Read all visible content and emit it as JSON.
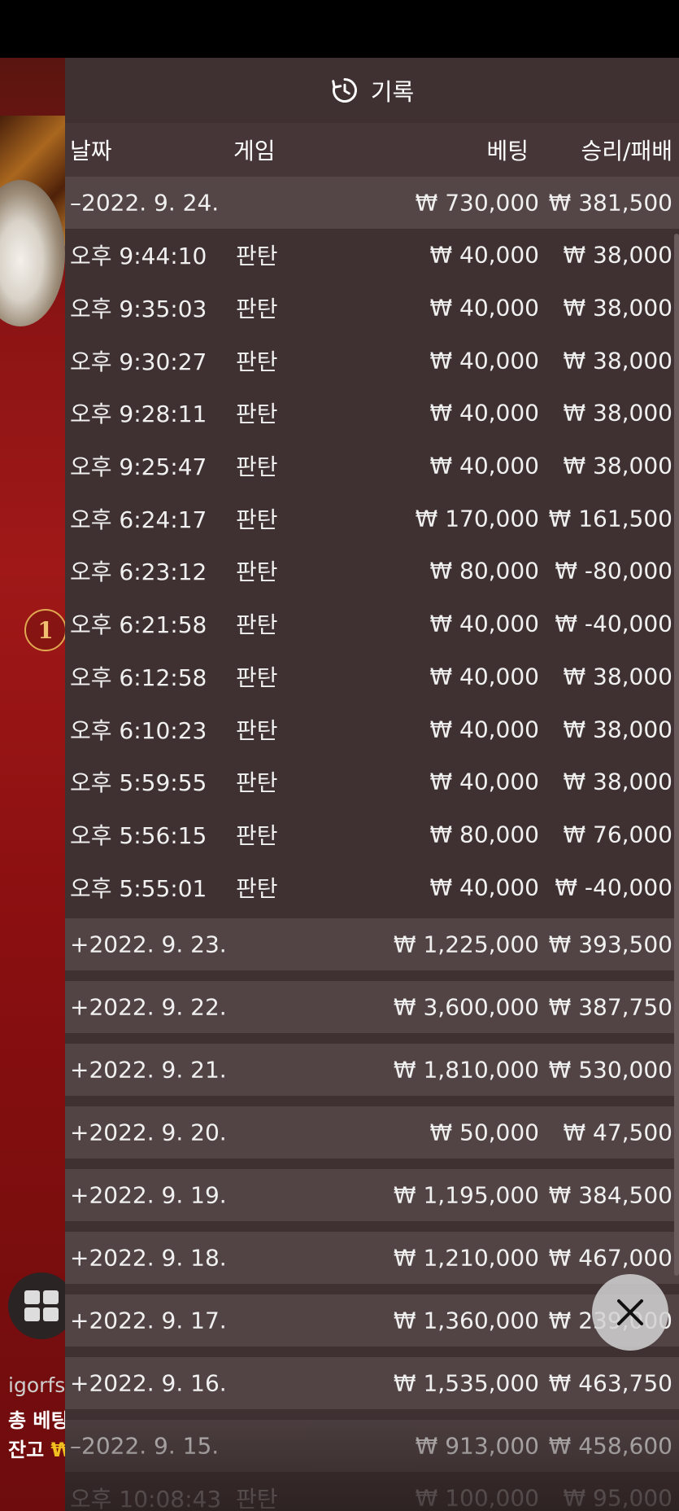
{
  "panel": {
    "title": "기록",
    "icon": "history-icon",
    "columns": {
      "date": "날짜",
      "game": "게임",
      "bet": "베팅",
      "result": "승리/패배"
    }
  },
  "expanded_day": {
    "date": "–2022. 9. 24.",
    "bet": "₩ 730,000",
    "result": "₩ 381,500",
    "entries": [
      {
        "time": "오후 9:44:10",
        "game": "판탄",
        "bet": "₩ 40,000",
        "result": "₩ 38,000"
      },
      {
        "time": "오후 9:35:03",
        "game": "판탄",
        "bet": "₩ 40,000",
        "result": "₩ 38,000"
      },
      {
        "time": "오후 9:30:27",
        "game": "판탄",
        "bet": "₩ 40,000",
        "result": "₩ 38,000"
      },
      {
        "time": "오후 9:28:11",
        "game": "판탄",
        "bet": "₩ 40,000",
        "result": "₩ 38,000"
      },
      {
        "time": "오후 9:25:47",
        "game": "판탄",
        "bet": "₩ 40,000",
        "result": "₩ 38,000"
      },
      {
        "time": "오후 6:24:17",
        "game": "판탄",
        "bet": "₩ 170,000",
        "result": "₩ 161,500"
      },
      {
        "time": "오후 6:23:12",
        "game": "판탄",
        "bet": "₩ 80,000",
        "result": "₩ -80,000"
      },
      {
        "time": "오후 6:21:58",
        "game": "판탄",
        "bet": "₩ 40,000",
        "result": "₩ -40,000"
      },
      {
        "time": "오후 6:12:58",
        "game": "판탄",
        "bet": "₩ 40,000",
        "result": "₩ 38,000"
      },
      {
        "time": "오후 6:10:23",
        "game": "판탄",
        "bet": "₩ 40,000",
        "result": "₩ 38,000"
      },
      {
        "time": "오후 5:59:55",
        "game": "판탄",
        "bet": "₩ 40,000",
        "result": "₩ 38,000"
      },
      {
        "time": "오후 5:56:15",
        "game": "판탄",
        "bet": "₩ 80,000",
        "result": "₩ 76,000"
      },
      {
        "time": "오후 5:55:01",
        "game": "판탄",
        "bet": "₩ 40,000",
        "result": "₩ -40,000"
      }
    ]
  },
  "collapsed_days": [
    {
      "date": "+2022. 9. 23.",
      "bet": "₩ 1,225,000",
      "result": "₩ 393,500"
    },
    {
      "date": "+2022. 9. 22.",
      "bet": "₩ 3,600,000",
      "result": "₩ 387,750"
    },
    {
      "date": "+2022. 9. 21.",
      "bet": "₩ 1,810,000",
      "result": "₩ 530,000"
    },
    {
      "date": "+2022. 9. 20.",
      "bet": "₩ 50,000",
      "result": "₩ 47,500"
    },
    {
      "date": "+2022. 9. 19.",
      "bet": "₩ 1,195,000",
      "result": "₩ 384,500"
    },
    {
      "date": "+2022. 9. 18.",
      "bet": "₩ 1,210,000",
      "result": "₩ 467,000"
    },
    {
      "date": "+2022. 9. 17.",
      "bet": "₩ 1,360,000",
      "result": "₩ 239,000"
    },
    {
      "date": "+2022. 9. 16.",
      "bet": "₩ 1,535,000",
      "result": "₩ 463,750"
    }
  ],
  "second_expanded_day": {
    "date": "–2022. 9. 15.",
    "bet": "₩ 913,000",
    "result": "₩ 458,600"
  },
  "partial_entry": {
    "time": "오후 10:08:43",
    "game": "판탄",
    "bet": "₩ 100,000",
    "result": "₩ 95,000"
  },
  "background": {
    "coin_label": "1",
    "user_name": "igorfs",
    "total_bet_label": "총 베팅",
    "balance_label": "잔고",
    "balance_currency": "₩"
  },
  "colors": {
    "panel": "#3f3132",
    "date_row": "#544546",
    "backdrop_red": "#a01818",
    "accent_gold": "#f0c020"
  }
}
